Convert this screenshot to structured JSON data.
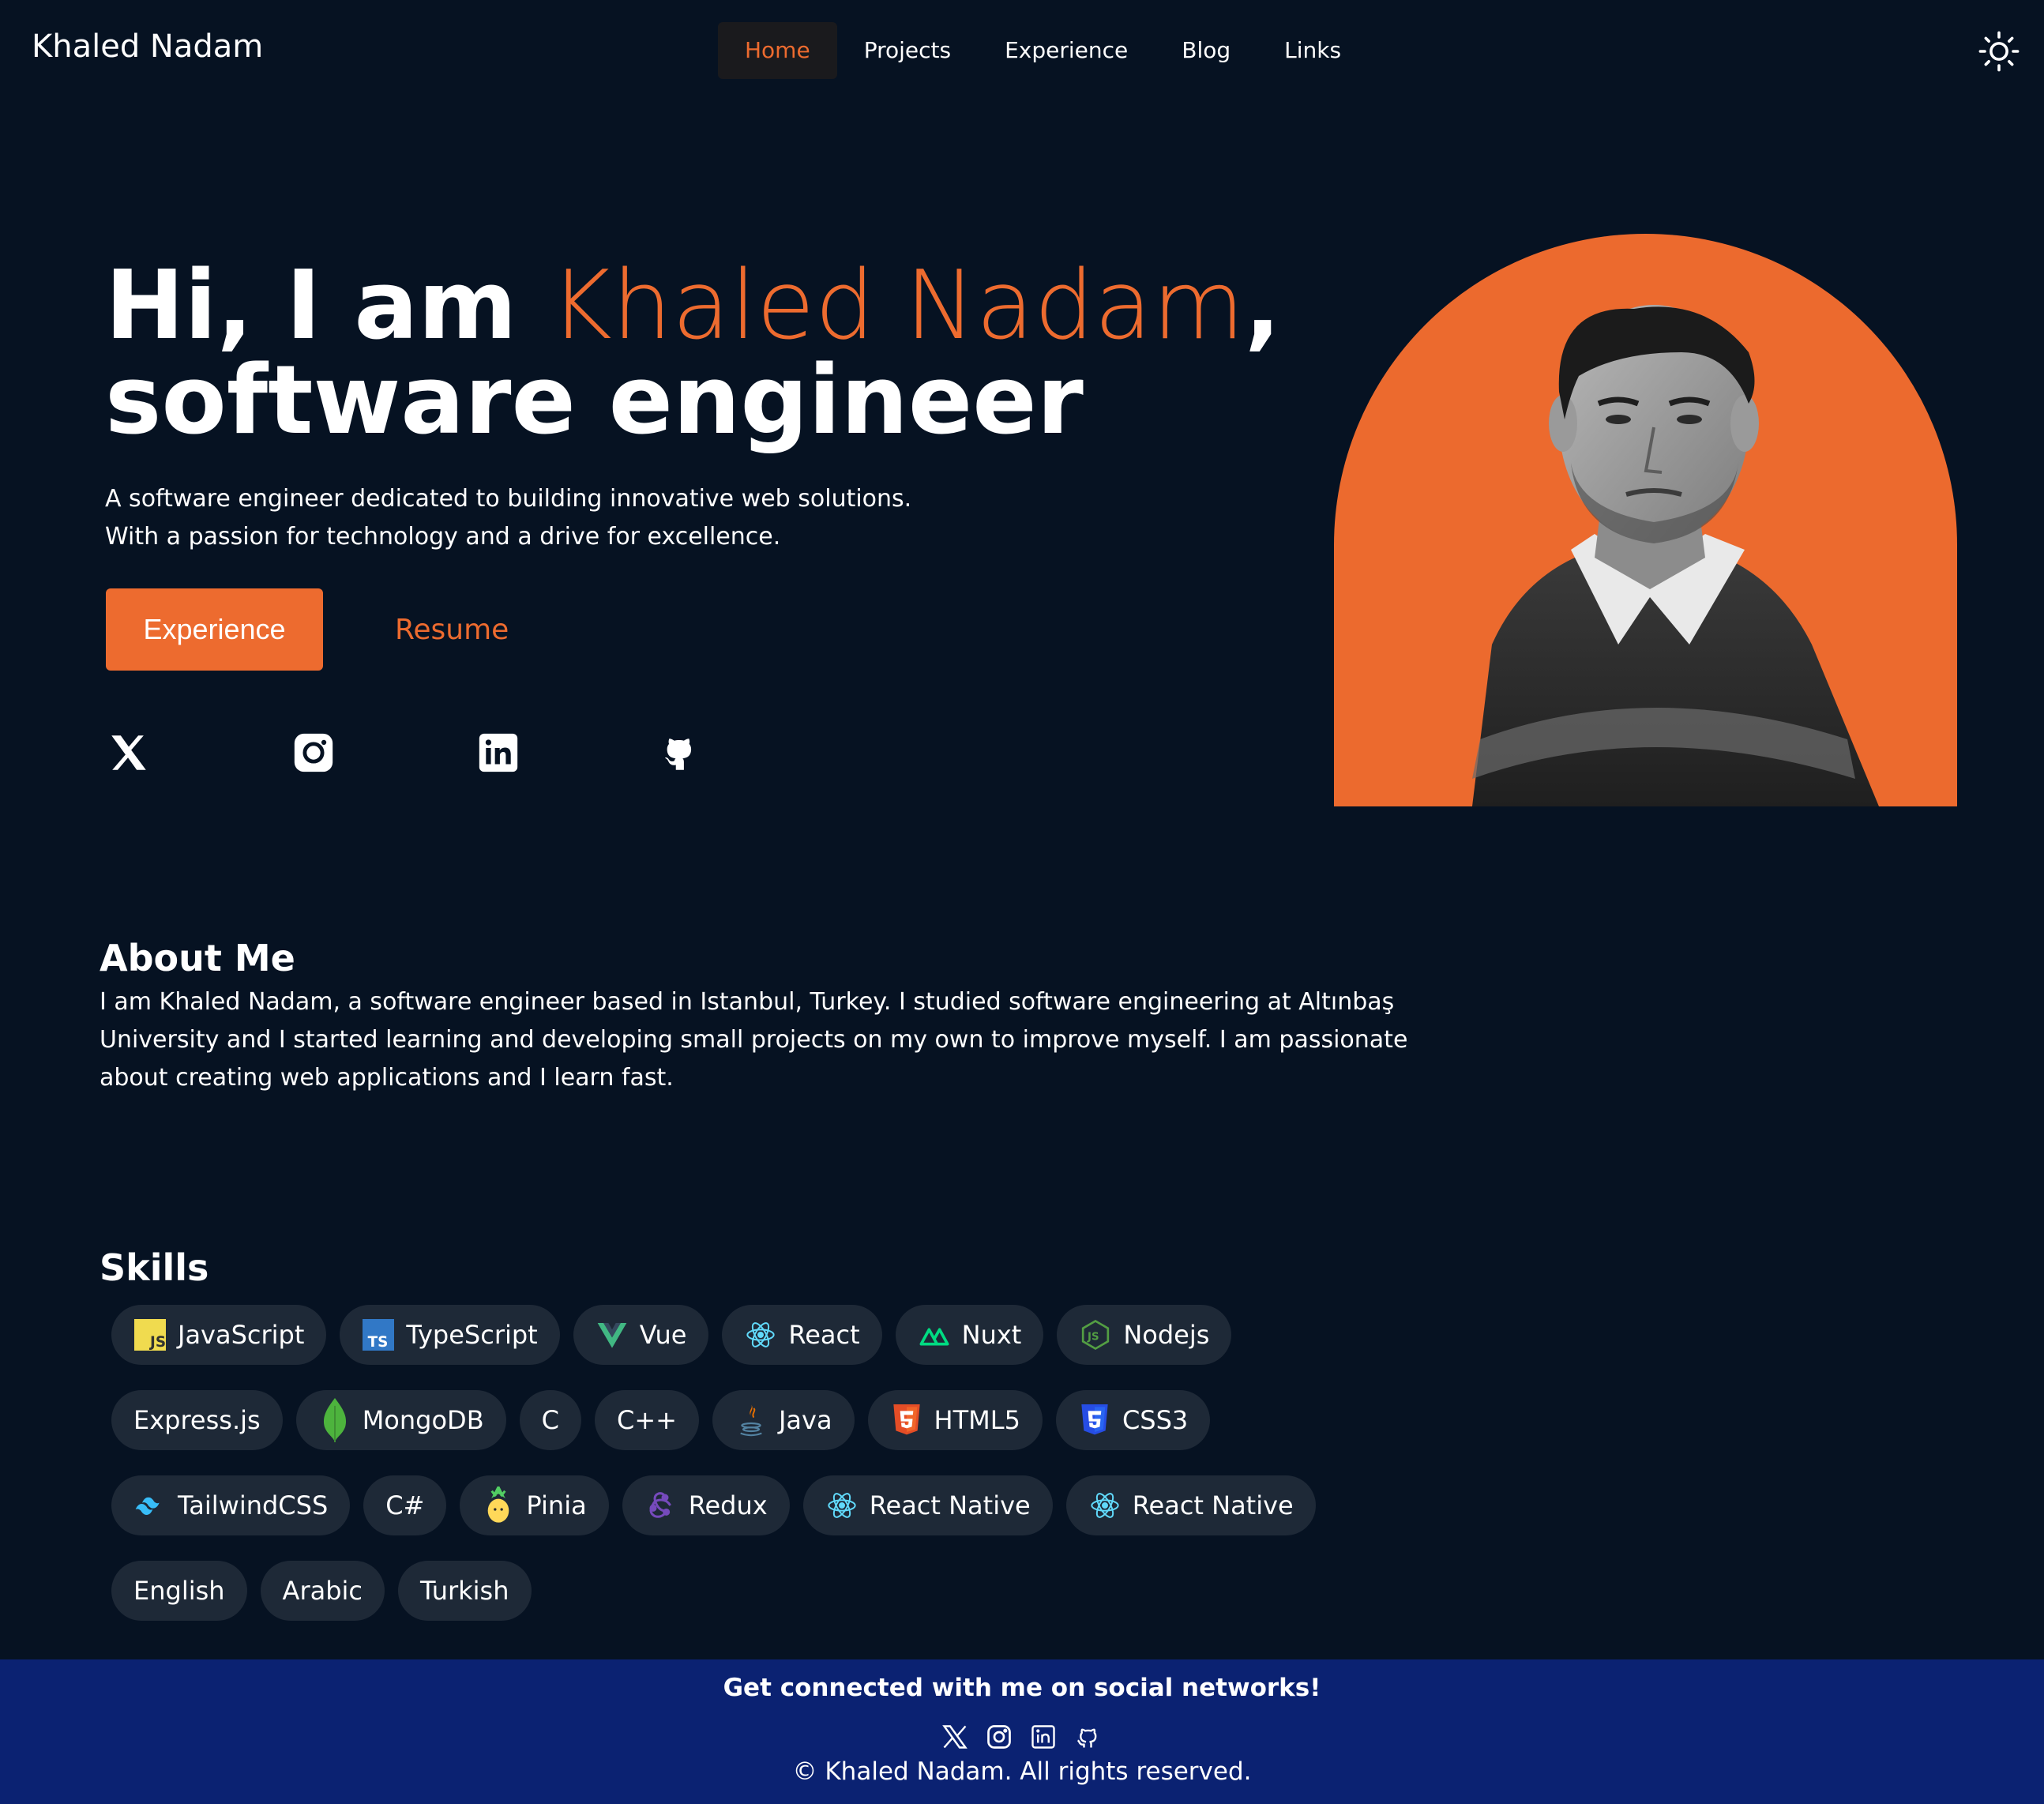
{
  "nav": {
    "brand": "Khaled Nadam",
    "links": [
      {
        "label": "Home",
        "active": true
      },
      {
        "label": "Projects"
      },
      {
        "label": "Experience"
      },
      {
        "label": "Blog"
      },
      {
        "label": "Links"
      }
    ],
    "theme_icon": "sun-icon"
  },
  "hero": {
    "greeting": "Hi, I am ",
    "name": "Khaled Nadam",
    "comma": ",",
    "role": "software engineer",
    "description": "A software engineer dedicated to building innovative web solutions. With a passion for technology and a drive for excellence.",
    "primary_button": "Experience",
    "secondary_button": "Resume",
    "socials": [
      "x-icon",
      "instagram-icon",
      "linkedin-icon",
      "github-icon"
    ]
  },
  "about": {
    "title": "About Me",
    "text": "I am Khaled Nadam, a software engineer based in Istanbul, Turkey. I studied software engineering at Altınbaş University and I started learning and developing small projects on my own to improve myself. I am passionate about creating web applications and I learn fast."
  },
  "skills": {
    "title": "Skills",
    "rows": [
      [
        "JavaScript",
        "TypeScript",
        "Vue",
        "React",
        "Nuxt",
        "Nodejs"
      ],
      [
        "Express.js",
        "MongoDB",
        "C",
        "C++",
        "Java",
        "HTML5",
        "CSS3"
      ],
      [
        "TailwindCSS",
        "C#",
        "Pinia",
        "Redux",
        "React Native",
        "React Native"
      ],
      [
        "English",
        "Arabic",
        "Turkish"
      ]
    ]
  },
  "footer": {
    "title": "Get connected with me on social networks!",
    "copyright": "© Khaled Nadam. All rights reserved."
  },
  "colors": {
    "background": "#061222",
    "accent": "#ed6b2f",
    "chip": "#1e2937",
    "footer": "#0b2272"
  }
}
